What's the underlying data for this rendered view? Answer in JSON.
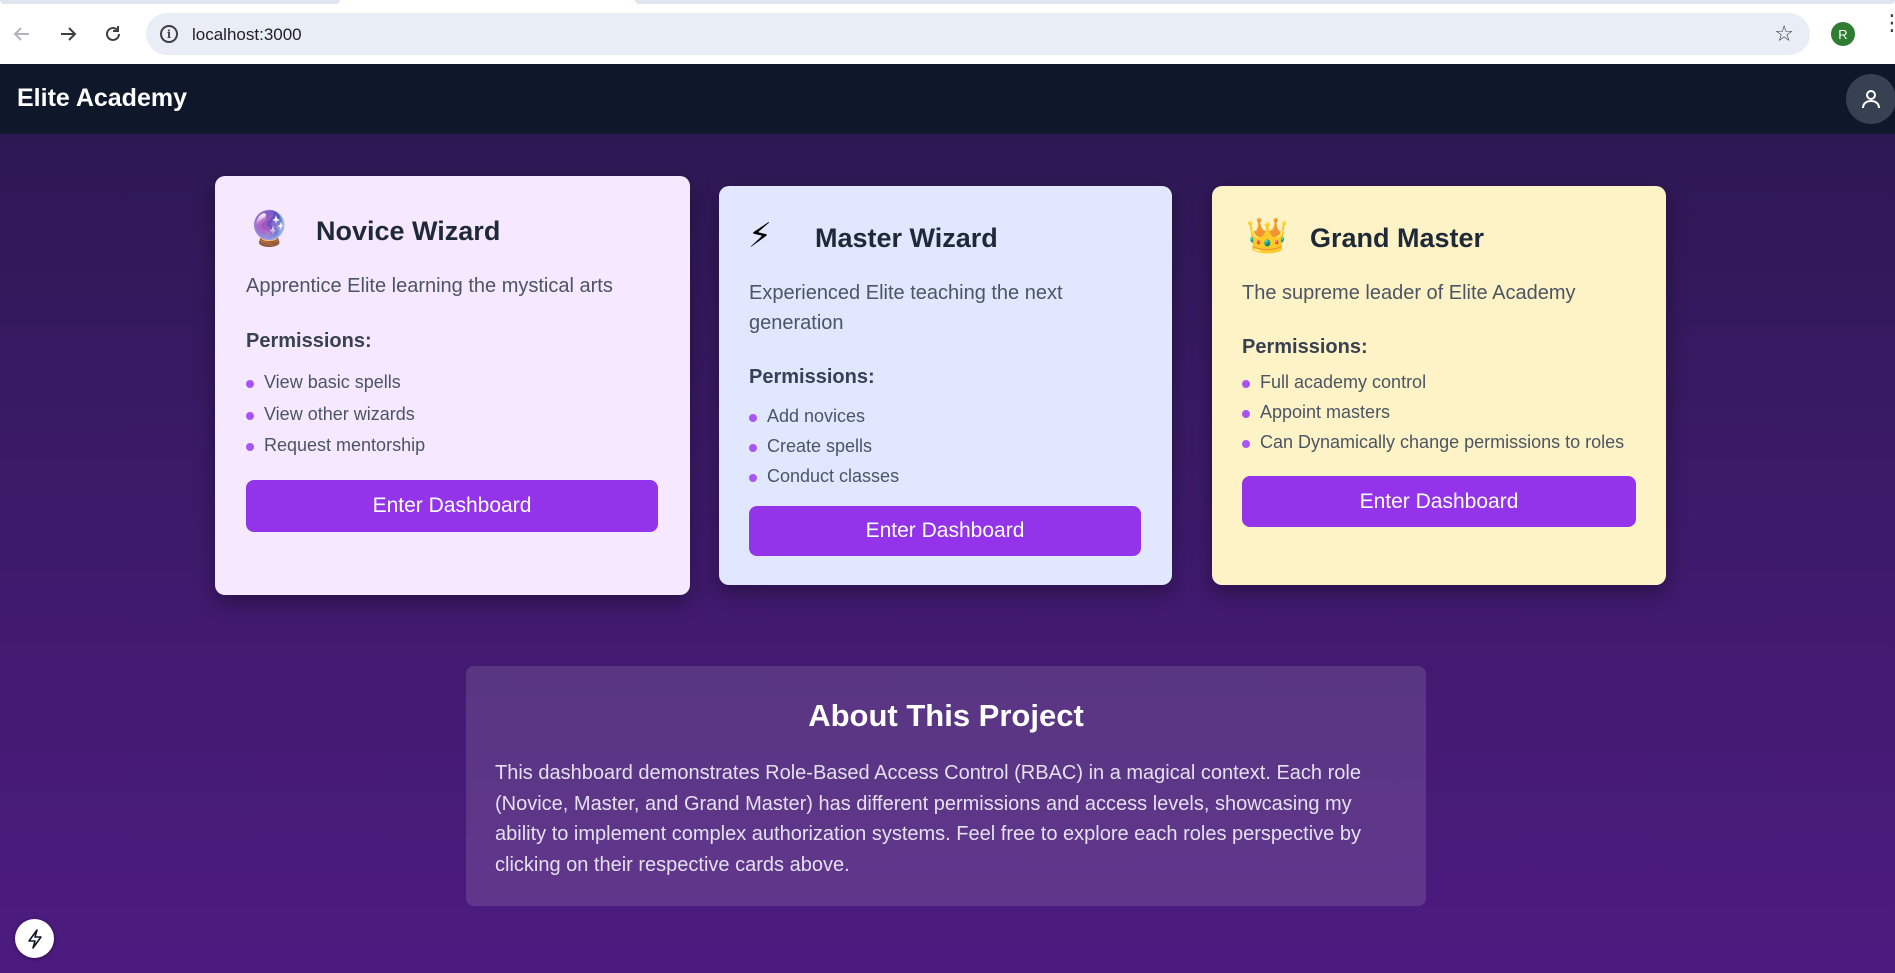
{
  "browser": {
    "url": "localhost:3000",
    "profile_initial": "R"
  },
  "app": {
    "brand": "Elite Academy",
    "accent_color": "#9333ea"
  },
  "roles": [
    {
      "icon": "🔮",
      "icon_name": "crystal-ball-icon",
      "title": "Novice Wizard",
      "description": "Apprentice Elite learning the mystical arts",
      "permissions_heading": "Permissions:",
      "permissions": [
        "View basic spells",
        "View other wizards",
        "Request mentorship"
      ],
      "cta": "Enter Dashboard",
      "bg_color": "#f5e8ff"
    },
    {
      "icon": "⚡",
      "icon_name": "lightning-icon",
      "title": "Master Wizard",
      "description": "Experienced Elite teaching the next generation",
      "permissions_heading": "Permissions:",
      "permissions": [
        "Add novices",
        "Create spells",
        "Conduct classes"
      ],
      "cta": "Enter Dashboard",
      "bg_color": "#e0e7ff"
    },
    {
      "icon": "👑",
      "icon_name": "crown-icon",
      "title": "Grand Master",
      "description": "The supreme leader of Elite Academy",
      "permissions_heading": "Permissions:",
      "permissions": [
        "Full academy control",
        "Appoint masters",
        "Can Dynamically change permissions to roles"
      ],
      "cta": "Enter Dashboard",
      "bg_color": "#fef3c7"
    }
  ],
  "about": {
    "title": "About This Project",
    "body": "This dashboard demonstrates Role-Based Access Control (RBAC) in a magical context. Each role (Novice, Master, and Grand Master) has different permissions and access levels, showcasing my ability to implement complex authorization systems. Feel free to explore each roles perspective by clicking on their respective cards above."
  }
}
